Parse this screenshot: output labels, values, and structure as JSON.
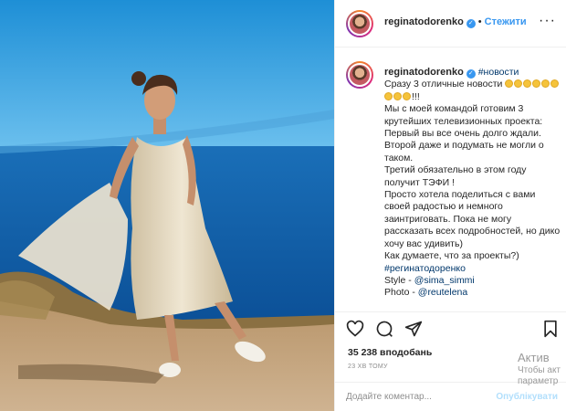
{
  "header": {
    "username": "reginatodorenko",
    "separator": "•",
    "follow_label": "Стежити",
    "more_label": "···"
  },
  "caption": {
    "username": "reginatodorenko",
    "hashtag_news": "#новости",
    "line_intro": "Сразу 3 отличные новости",
    "exclaim": "!!!",
    "body_1": "Мы с моей командой готовим 3 крутейших телевизионных проекта:",
    "body_2": "Первый вы все очень долго ждали.",
    "body_3": "Второй даже и подумать не могли о таком.",
    "body_4": "Третий обязательно в этом году получит ТЭФИ !",
    "body_5": "Просто хотела поделиться с вами своей радостью и немного заинтриговать. Пока не могу рассказать всех подробностей, но дико хочу вас удивить)",
    "body_6": "Как думаете, что за проекты?)",
    "hashtag_name": "#регинатодоренко",
    "style_prefix": "Style - ",
    "style_mention": "@sima_simmi",
    "photo_prefix": "Photo - ",
    "photo_mention": "@reutelena"
  },
  "actions": {
    "icons": [
      "heart-icon",
      "comment-icon",
      "share-icon",
      "bookmark-icon"
    ]
  },
  "likes": {
    "count": "35 238",
    "label": "вподобань"
  },
  "time": "23 ХВ ТОМУ",
  "comment": {
    "placeholder": "Додайте коментар...",
    "publish_label": "Опублікувати"
  },
  "watermark": {
    "line1": "Актив",
    "line2": "Чтобы акт",
    "line3": "параметр"
  },
  "colors": {
    "accent": "#3897f0",
    "link": "#00376b",
    "muted": "#8e8e8e",
    "publish_disabled": "#b2dffc",
    "sky": "#1e8fd6",
    "sea": "#0d5fa8"
  }
}
